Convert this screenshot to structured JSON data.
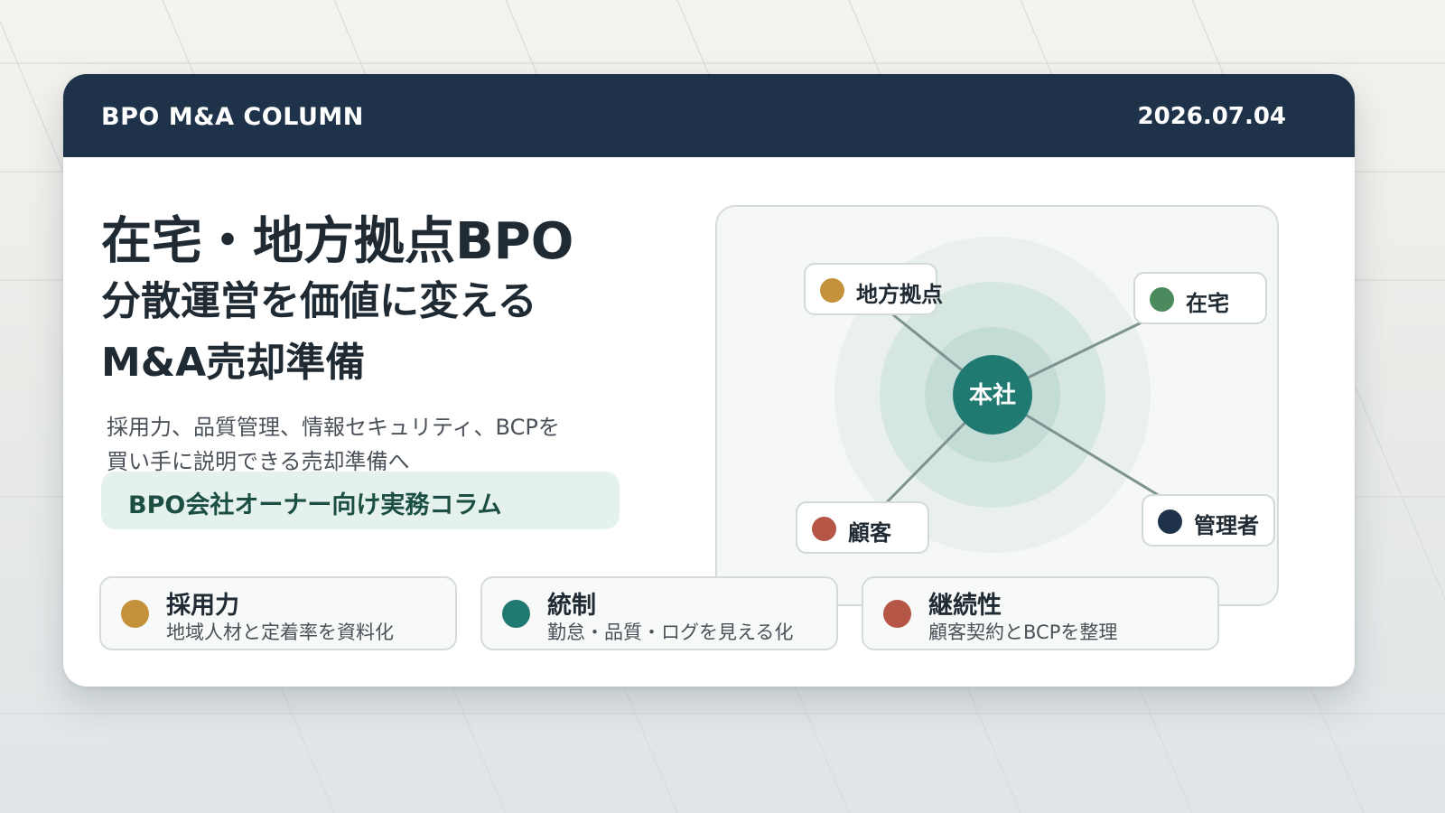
{
  "header": {
    "brand": "BPO M&A COLUMN",
    "date": "2026.07.04"
  },
  "headline": {
    "line1": "在宅・地方拠点BPO",
    "line2": "分散運営を価値に変える",
    "line3": "M&A売却準備"
  },
  "description": {
    "line1": "採用力、品質管理、情報セキュリティ、BCPを",
    "line2": "買い手に説明できる売却準備へ"
  },
  "tag": "BPO会社オーナー向け実務コラム",
  "diagram": {
    "center": "本社",
    "nodes": [
      {
        "label": "地方拠点",
        "color": "#c4923a"
      },
      {
        "label": "在宅",
        "color": "#4a8a5c"
      },
      {
        "label": "顧客",
        "color": "#b65646"
      },
      {
        "label": "管理者",
        "color": "#1e3349"
      }
    ]
  },
  "features": [
    {
      "title": "採用力",
      "subtitle": "地域人材と定着率を資料化",
      "color": "#c4923a"
    },
    {
      "title": "統制",
      "subtitle": "勤怠・品質・ログを見える化",
      "color": "#217a72"
    },
    {
      "title": "継続性",
      "subtitle": "顧客契約とBCPを整理",
      "color": "#b65646"
    }
  ],
  "colors": {
    "navy": "#1e3349",
    "teal": "#217a72",
    "gold": "#c4923a",
    "green": "#4a8a5c",
    "red": "#b65646"
  }
}
